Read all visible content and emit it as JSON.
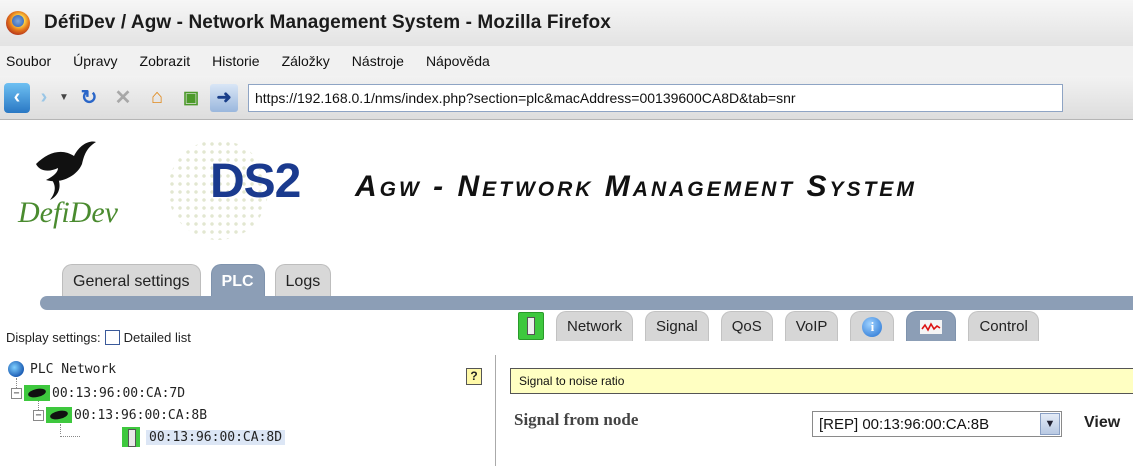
{
  "browser": {
    "window_title": "DéfiDev / Agw - Network Management System - Mozilla Firefox",
    "menu": [
      "Soubor",
      "Úpravy",
      "Zobrazit",
      "Historie",
      "Záložky",
      "Nástroje",
      "Nápověda"
    ],
    "url": "https://192.168.0.1/nms/index.php?section=plc&macAddress=00139600CA8D&tab=snr"
  },
  "header": {
    "brand": "DefiDev",
    "product": "DS2",
    "system_title": "Agw - Network Management System"
  },
  "app_tabs": [
    {
      "label": "General settings",
      "active": false
    },
    {
      "label": "PLC",
      "active": true
    },
    {
      "label": "Logs",
      "active": false
    }
  ],
  "left_panel": {
    "display_settings_label": "Display settings:",
    "detailed_list_label": "Detailed list",
    "detailed_list_checked": false,
    "help_label": "?",
    "tree": {
      "root": "PLC Network",
      "nodes": [
        {
          "label": "00:13:96:00:CA:7D",
          "level": 1
        },
        {
          "label": "00:13:96:00:CA:8B",
          "level": 2
        },
        {
          "label": "00:13:96:00:CA:8D",
          "level": 3,
          "selected": true
        }
      ]
    }
  },
  "right_panel": {
    "subtabs": [
      "Network",
      "Signal",
      "QoS",
      "VoIP",
      "Control"
    ],
    "active_subtab": "snr",
    "banner": "Signal to noise ratio",
    "signal_from_label": "Signal from node",
    "node_select_value": "[REP] 00:13:96:00:CA:8B",
    "view_label": "View"
  },
  "colors": {
    "tab_active": "#8c9eb6",
    "device_green": "#3ec83e",
    "banner_yellow": "#ffffc2",
    "ds2_blue": "#1a3a8e"
  }
}
